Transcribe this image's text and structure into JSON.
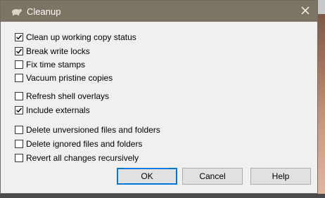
{
  "dialog": {
    "title": "Cleanup",
    "close_label": "✕"
  },
  "options": [
    {
      "label": "Clean up working copy status",
      "checked": true
    },
    {
      "label": "Break write locks",
      "checked": true
    },
    {
      "label": "Fix time stamps",
      "checked": false
    },
    {
      "label": "Vacuum pristine copies",
      "checked": false
    },
    {
      "label": "Refresh shell overlays",
      "checked": false
    },
    {
      "label": "Include externals",
      "checked": true
    },
    {
      "label": "Delete unversioned files and folders",
      "checked": false
    },
    {
      "label": "Delete ignored files and folders",
      "checked": false
    },
    {
      "label": "Revert all changes recursively",
      "checked": false
    }
  ],
  "buttons": {
    "ok": "OK",
    "cancel": "Cancel",
    "help": "Help"
  }
}
